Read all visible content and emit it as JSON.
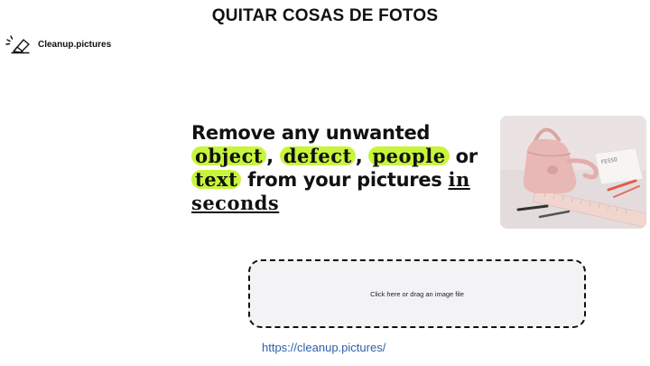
{
  "slide": {
    "title": "QUITAR COSAS DE FOTOS"
  },
  "app": {
    "brand_name": "Cleanup.pictures",
    "logo_icon": "eraser-sparkle-icon"
  },
  "hero": {
    "line1": "Remove any unwanted",
    "highlights": [
      "object",
      "defect",
      "people",
      "text"
    ],
    "separators": [
      ",",
      ","
    ],
    "or_word": "or",
    "from_text": "from your pictures",
    "underlined": [
      "in",
      "seconds"
    ],
    "highlight_color": "#c8f53c"
  },
  "example_image": {
    "subject": "pink handbag with ruler and pens on desk"
  },
  "dropzone": {
    "label": "Click here or drag an image file"
  },
  "footer": {
    "url": "https://cleanup.pictures/"
  }
}
